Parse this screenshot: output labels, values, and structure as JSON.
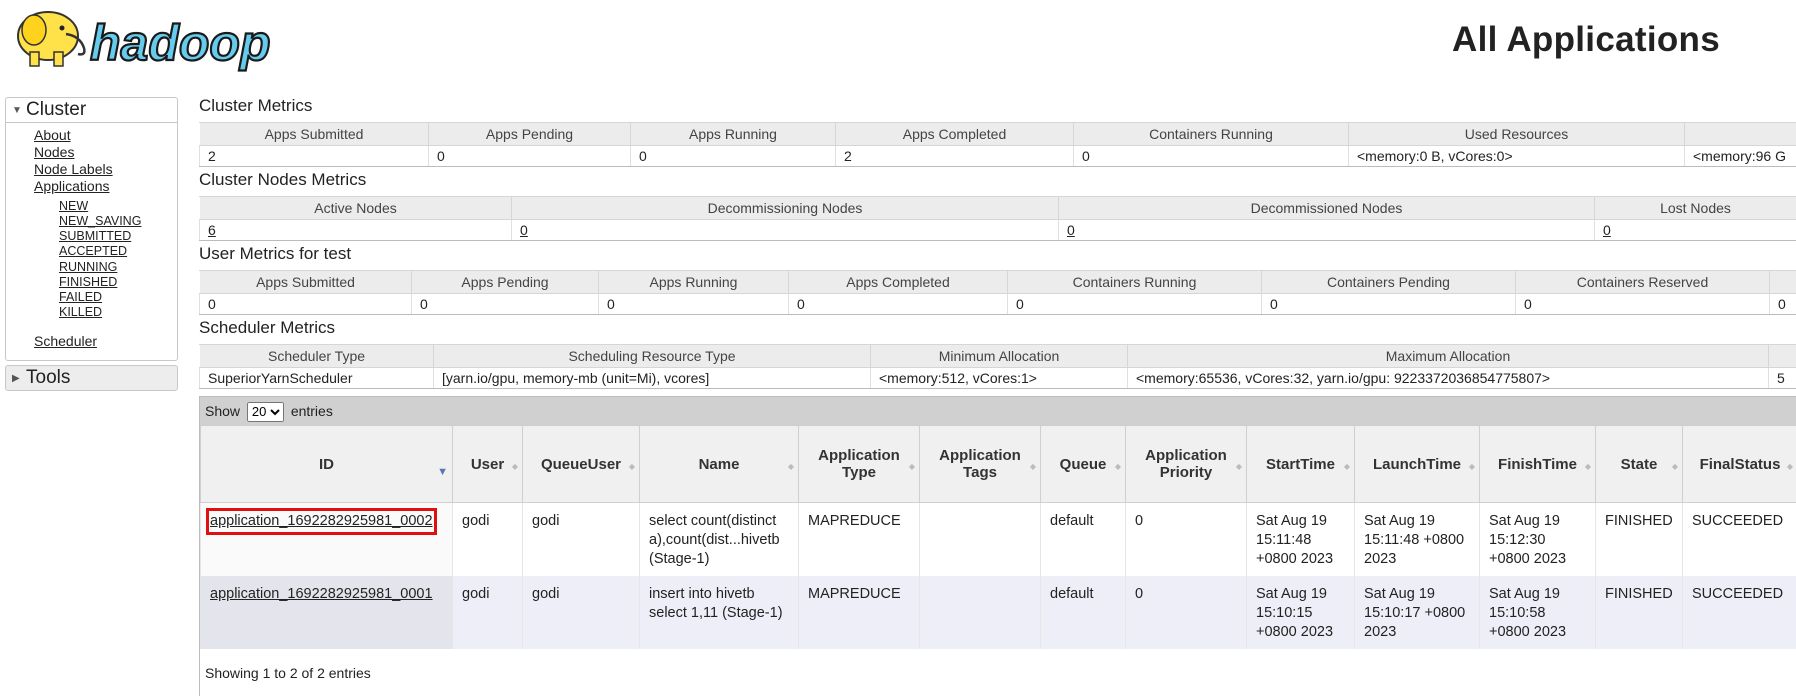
{
  "header": {
    "title": "All Applications",
    "logo_text": "hadoop"
  },
  "sidebar": {
    "cluster_label": "Cluster",
    "tools_label": "Tools",
    "links": [
      "About",
      "Nodes",
      "Node Labels",
      "Applications"
    ],
    "states": [
      "NEW",
      "NEW_SAVING",
      "SUBMITTED",
      "ACCEPTED",
      "RUNNING",
      "FINISHED",
      "FAILED",
      "KILLED"
    ],
    "scheduler": "Scheduler"
  },
  "cluster_metrics": {
    "title": "Cluster Metrics",
    "headers": [
      "Apps Submitted",
      "Apps Pending",
      "Apps Running",
      "Apps Completed",
      "Containers Running",
      "Used Resources",
      ""
    ],
    "values": [
      "2",
      "0",
      "0",
      "2",
      "0",
      "<memory:0 B, vCores:0>",
      "<memory:96 G"
    ]
  },
  "nodes_metrics": {
    "title": "Cluster Nodes Metrics",
    "headers": [
      "Active Nodes",
      "Decommissioning Nodes",
      "Decommissioned Nodes",
      "Lost Nodes"
    ],
    "values": [
      "6",
      "0",
      "0",
      "0"
    ]
  },
  "user_metrics": {
    "title": "User Metrics for test",
    "headers": [
      "Apps Submitted",
      "Apps Pending",
      "Apps Running",
      "Apps Completed",
      "Containers Running",
      "Containers Pending",
      "Containers Reserved",
      ""
    ],
    "values": [
      "0",
      "0",
      "0",
      "0",
      "0",
      "0",
      "0",
      "0"
    ]
  },
  "scheduler_metrics": {
    "title": "Scheduler Metrics",
    "headers": [
      "Scheduler Type",
      "Scheduling Resource Type",
      "Minimum Allocation",
      "Maximum Allocation",
      ""
    ],
    "values": [
      "SuperiorYarnScheduler",
      "[yarn.io/gpu, memory-mb (unit=Mi), vcores]",
      "<memory:512, vCores:1>",
      "<memory:65536, vCores:32, yarn.io/gpu: 9223372036854775807>",
      "5"
    ]
  },
  "apps": {
    "show_label": "Show",
    "entries_label": "entries",
    "page_size": "20",
    "columns": [
      "ID",
      "User",
      "QueueUser",
      "Name",
      "Application Type",
      "Application Tags",
      "Queue",
      "Application Priority",
      "StartTime",
      "LaunchTime",
      "FinishTime",
      "State",
      "FinalStatus"
    ],
    "rows": [
      {
        "id": "application_1692282925981_0002",
        "user": "godi",
        "queue_user": "godi",
        "name": "select count(distinct a),count(dist...hivetb (Stage-1)",
        "type": "MAPREDUCE",
        "tags": "",
        "queue": "default",
        "priority": "0",
        "start": "Sat Aug 19 15:11:48 +0800 2023",
        "launch": "Sat Aug 19 15:11:48 +0800 2023",
        "finish": "Sat Aug 19 15:12:30 +0800 2023",
        "state": "FINISHED",
        "final": "SUCCEEDED"
      },
      {
        "id": "application_1692282925981_0001",
        "user": "godi",
        "queue_user": "godi",
        "name": "insert into hivetb select 1,11 (Stage-1)",
        "type": "MAPREDUCE",
        "tags": "",
        "queue": "default",
        "priority": "0",
        "start": "Sat Aug 19 15:10:15 +0800 2023",
        "launch": "Sat Aug 19 15:10:17 +0800 2023",
        "finish": "Sat Aug 19 15:10:58 +0800 2023",
        "state": "FINISHED",
        "final": "SUCCEEDED"
      }
    ],
    "info": "Showing 1 to 2 of 2 entries"
  },
  "colors": {
    "highlight": "#e01010",
    "header_bg": "#ececec",
    "row_alt": "#eeeef9",
    "logo_yellow": "#ffe14a",
    "logo_blue": "#66ccee"
  }
}
